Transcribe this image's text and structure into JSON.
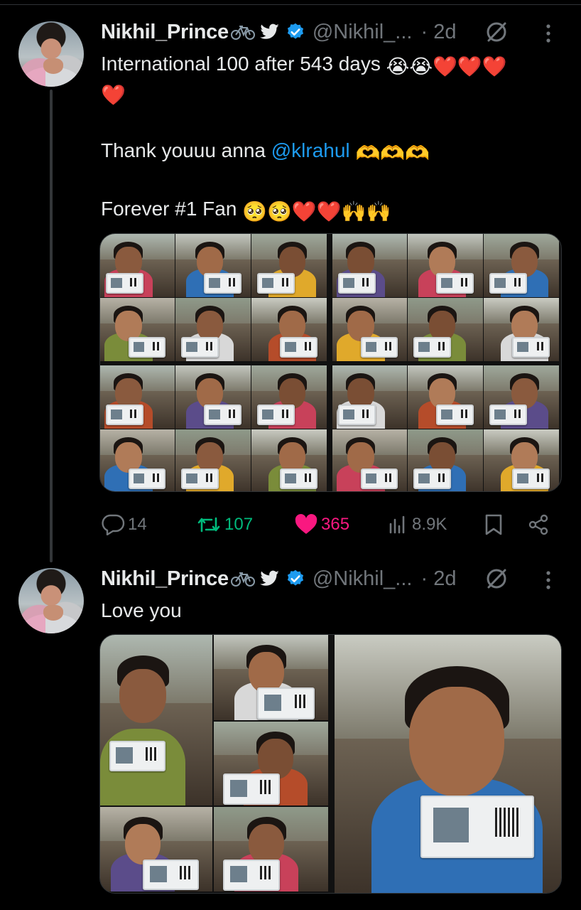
{
  "tweets": [
    {
      "author_name": "Nikhil_Prince",
      "handle": "@Nikhil_...",
      "time": "· 2d",
      "line1": "International 100 after 543 days ",
      "line2_emoji": "❤️",
      "line3_prefix": "Thank youuu anna ",
      "mention": "@klrahul",
      "line4": "Forever #1 Fan ",
      "emoji_line1": "😭😭❤️❤️❤️",
      "emoji_line3": "🫶🫶🫶",
      "emoji_line4": "🥺🥺❤️❤️🙌🙌",
      "stats": {
        "replies": "14",
        "retweets": "107",
        "likes": "365",
        "views": "8.9K"
      }
    },
    {
      "author_name": "Nikhil_Prince",
      "handle": "@Nikhil_...",
      "time": "· 2d",
      "text": "Love you"
    }
  ],
  "icons": {
    "bike": "bicycle-icon",
    "bird": "bird-icon",
    "verified": "verified-badge-icon",
    "grok": "grok-icon",
    "more": "more-vertical-icon",
    "reply": "reply-icon",
    "retweet": "retweet-icon",
    "like": "heart-icon",
    "views": "views-icon",
    "bookmark": "bookmark-icon",
    "share": "share-icon"
  },
  "colors": {
    "background": "#000000",
    "text": "#e7e9ea",
    "secondary": "#71767b",
    "mention": "#1d9bf0",
    "retweet": "#00ba7c",
    "like": "#f91880",
    "verified": "#1d9bf0"
  }
}
